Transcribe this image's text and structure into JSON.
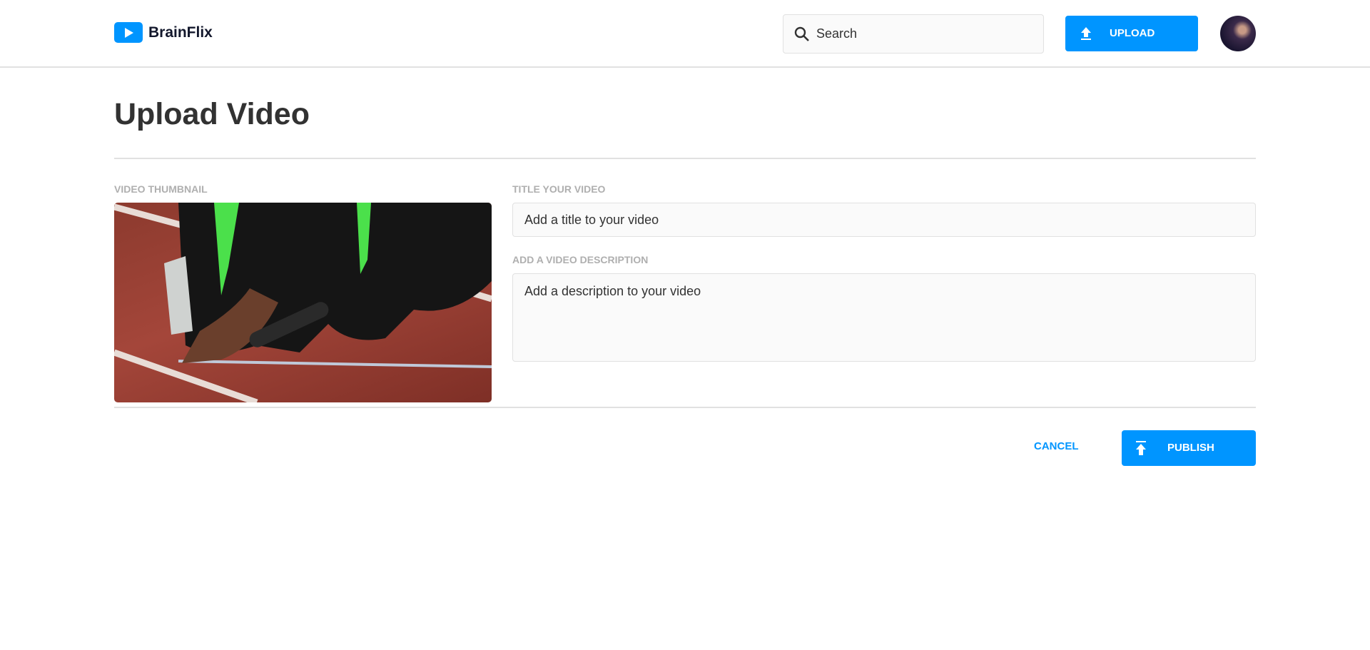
{
  "header": {
    "brand": "BrainFlix",
    "search_placeholder": "Search",
    "upload_label": "UPLOAD"
  },
  "page": {
    "title": "Upload Video",
    "thumbnail_label": "VIDEO THUMBNAIL",
    "title_label": "TITLE YOUR VIDEO",
    "title_placeholder": "Add a title to your video",
    "description_label": "ADD A VIDEO DESCRIPTION",
    "description_placeholder": "Add a description to your video",
    "cancel_label": "CANCEL",
    "publish_label": "PUBLISH"
  },
  "colors": {
    "accent": "#0095ff",
    "text": "#323232",
    "label": "#afafaf",
    "border": "#e1e1e1"
  }
}
